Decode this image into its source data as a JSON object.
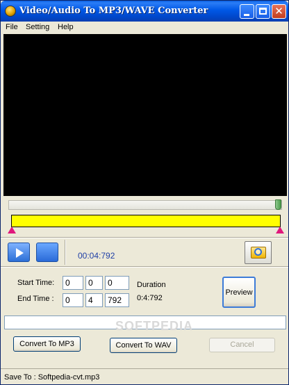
{
  "window": {
    "title": "Video/Audio To MP3/WAVE Converter",
    "icons": {
      "app": "app-disc-icon",
      "minimize": "minimize-icon",
      "maximize": "maximize-icon",
      "close": "close-icon"
    },
    "close_glyph": "✕"
  },
  "menu": {
    "file": "File",
    "setting": "Setting",
    "help": "Help"
  },
  "playback": {
    "time_display": "00:04:792",
    "seek_position": 1.0,
    "icons": {
      "play": "play-icon",
      "stop": "stop-icon",
      "open": "folder-search-icon"
    }
  },
  "range": {
    "start_fraction": 0.0,
    "end_fraction": 1.0,
    "color": "#ffff00",
    "marker_color": "#e0187c"
  },
  "times": {
    "start_label": "Start Time:",
    "end_label": "End Time :",
    "start": {
      "h": "0",
      "m": "0",
      "s": "0"
    },
    "end": {
      "h": "0",
      "m": "4",
      "ms": "792"
    },
    "duration_label": "Duration",
    "duration_value": "0:4:792"
  },
  "buttons": {
    "preview": "Preview",
    "convert_mp3": "Convert To MP3",
    "convert_wav": "Convert To WAV",
    "cancel": "Cancel"
  },
  "progress": {
    "value": 0,
    "watermark": "SOFTPEDIA"
  },
  "status": {
    "save_to": "Save To : Softpedia-cvt.mp3"
  }
}
